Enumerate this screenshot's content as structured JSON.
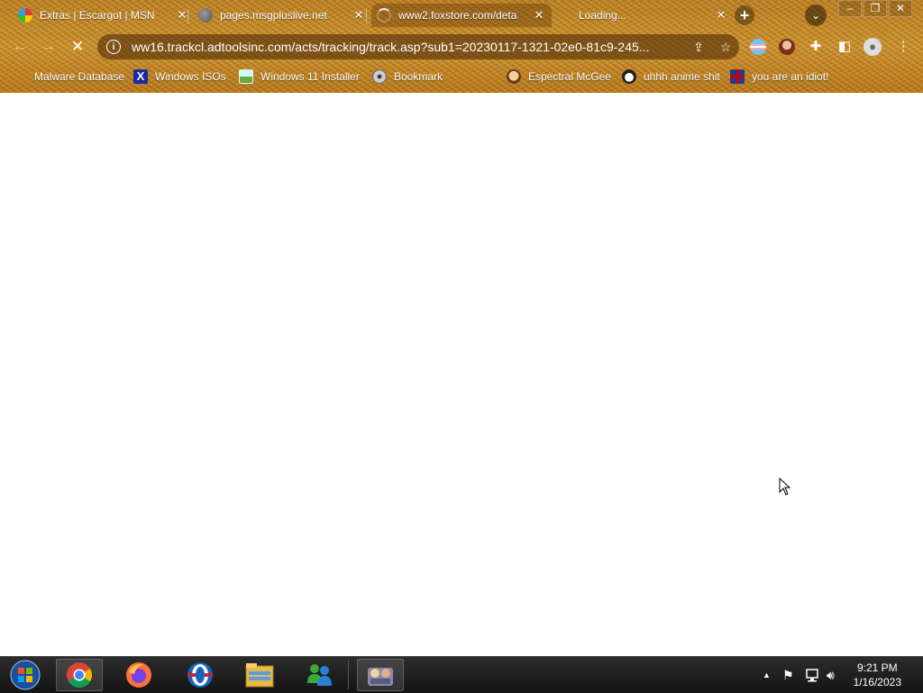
{
  "browser": {
    "tabs": [
      {
        "title": "Extras | Escargot | MSN",
        "favicon": "escargot-icon",
        "close": "✕",
        "active": false
      },
      {
        "title": "pages.msgpluslive.net",
        "favicon": "globe-icon",
        "close": "✕",
        "active": false
      },
      {
        "title": "www2.foxstore.com/deta",
        "favicon": "loading-spinner-icon",
        "close": "✕",
        "active": true
      },
      {
        "title": "Loading...",
        "favicon": "none",
        "close": "✕",
        "active": false
      }
    ],
    "new_tab_icon": "+",
    "tab_search_icon": "⌄",
    "window_controls": {
      "minimize": "–",
      "restore": "❐",
      "close": "✕"
    },
    "toolbar": {
      "back_icon": "←",
      "forward_icon": "→",
      "stop_icon": "✕",
      "url": "ww16.trackcl.adtoolsinc.com/acts/tracking/track.asp?sub1=20230117-1321-02e0-81c9-245...",
      "info_icon": "i",
      "share_icon": "⇪",
      "star_icon": "☆"
    },
    "bookmarks": [
      {
        "label": "Malware Database",
        "icon": "leaf-icon"
      },
      {
        "label": "Windows ISOs",
        "icon": "x-logo-icon"
      },
      {
        "label": "Windows 11 Installer",
        "icon": "image-icon"
      },
      {
        "label": "Bookmark",
        "icon": "disc-icon"
      },
      {
        "label": "Espectral McGee",
        "icon": "face-icon"
      },
      {
        "label": "uhhh anime shit",
        "icon": "anime-face-icon"
      },
      {
        "label": "you are an idiot!",
        "icon": "uk-flag-icon"
      }
    ],
    "accent_color": "#c98d2a"
  },
  "taskbar": {
    "apps": [
      "start-orb",
      "chrome-icon",
      "firefox-icon",
      "opera-icon",
      "file-explorer-icon",
      "msn-messenger-icon",
      "app-icon"
    ],
    "tray_icons": [
      "show-hidden-icons",
      "action-center-flag-icon",
      "network-icon",
      "volume-icon"
    ],
    "time": "9:21 PM",
    "date": "1/16/2023"
  }
}
